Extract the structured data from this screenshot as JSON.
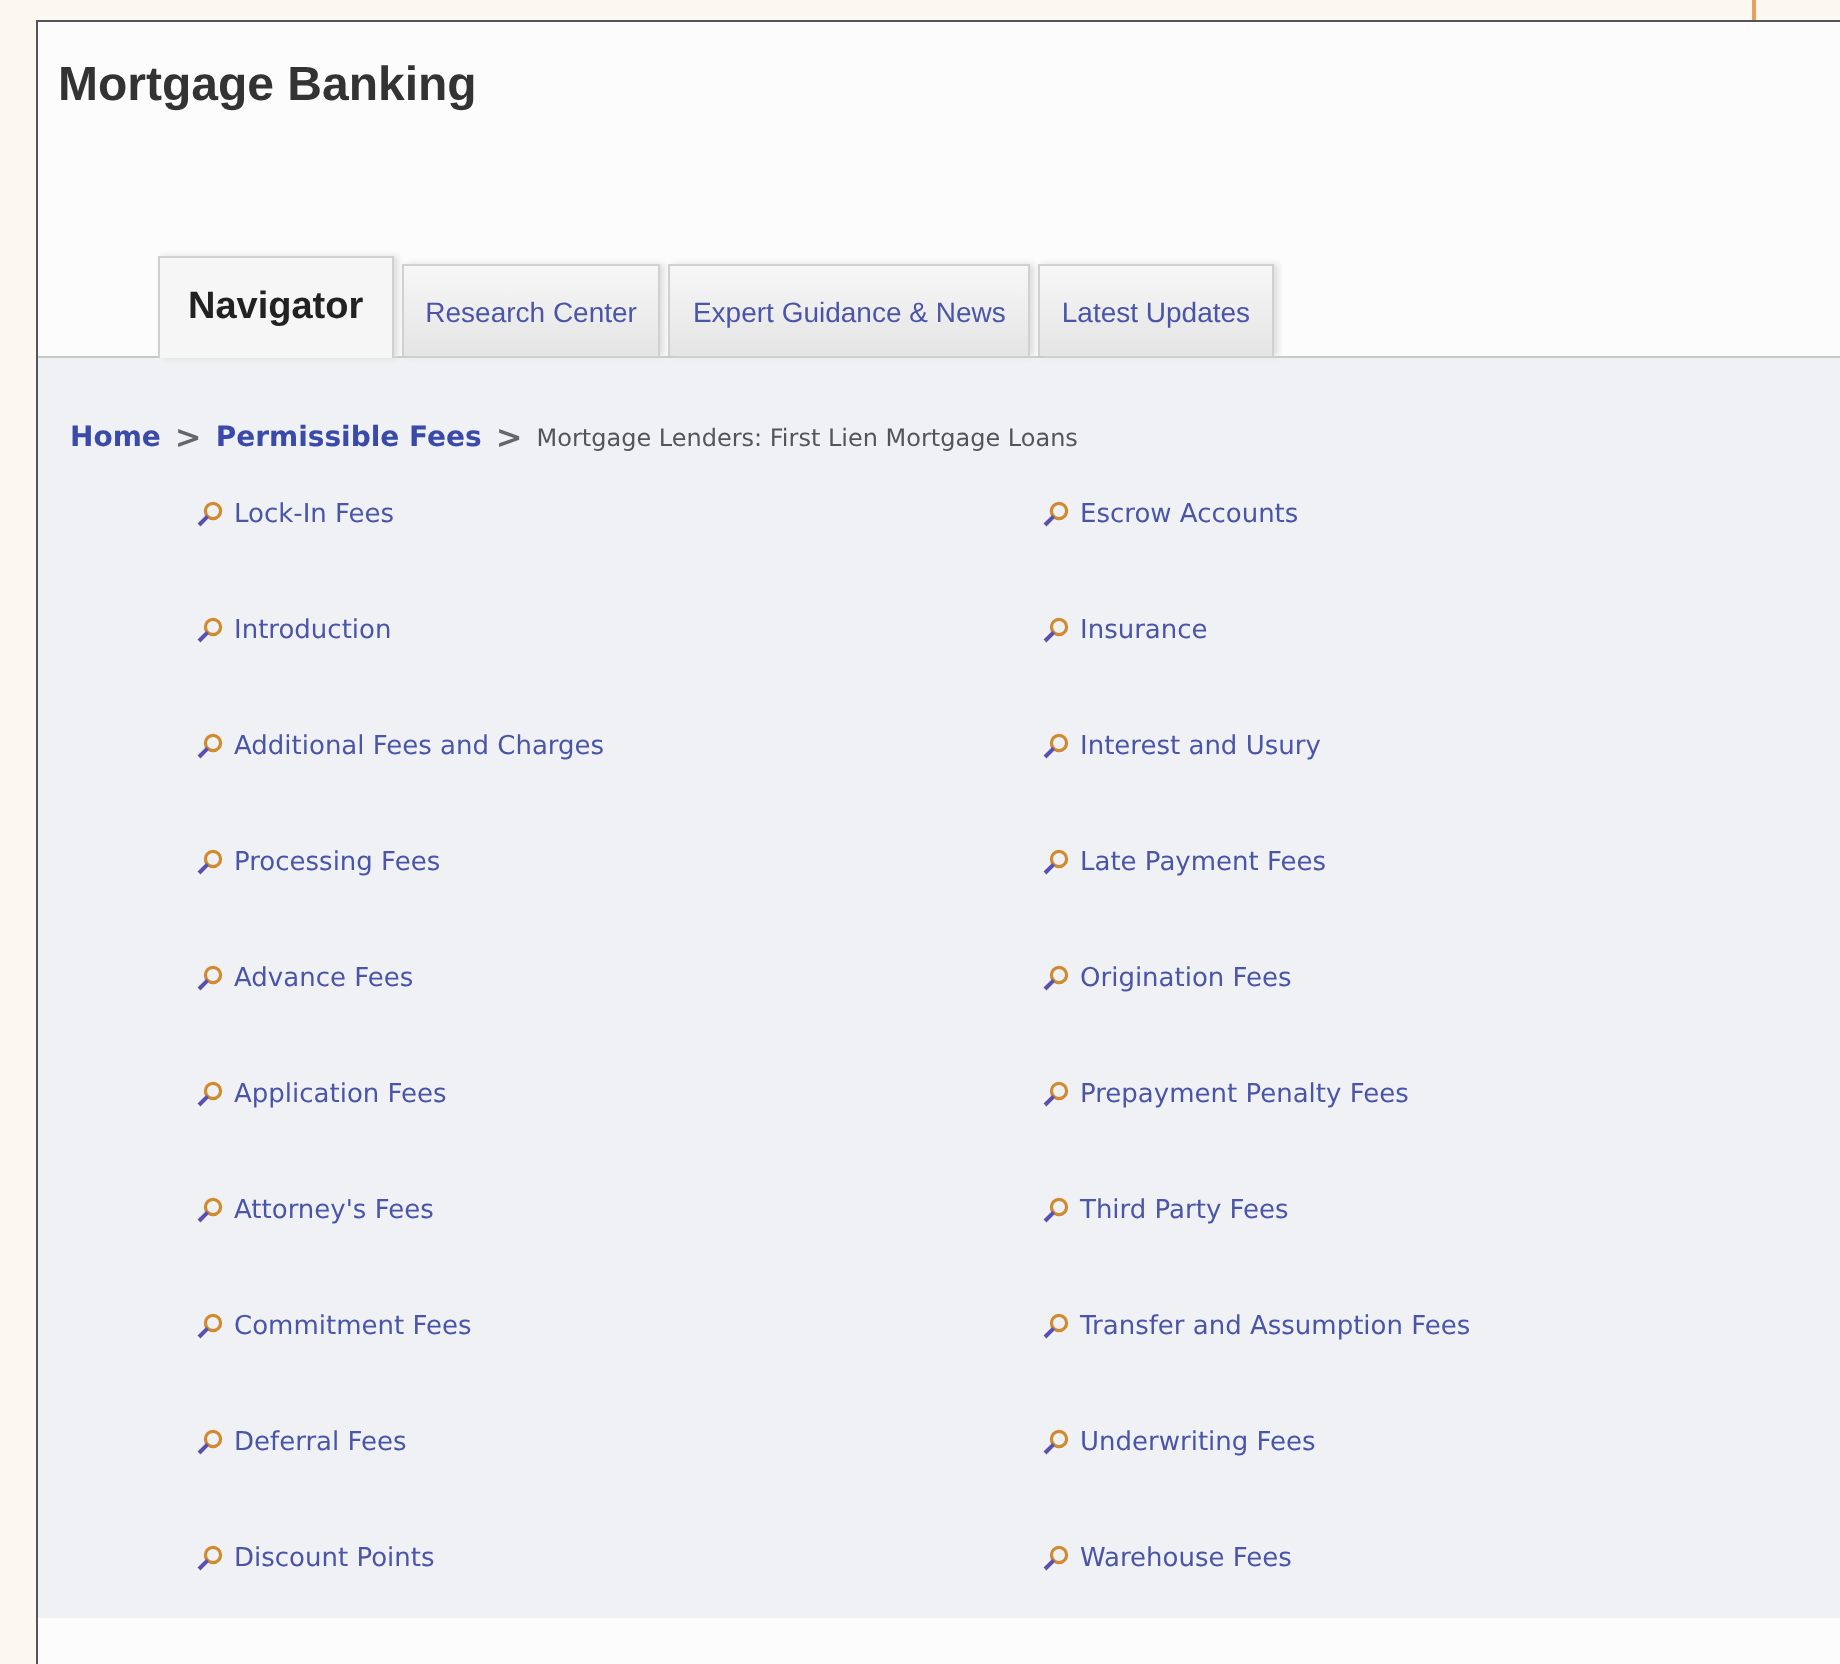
{
  "title": "Mortgage Banking",
  "tabs": [
    {
      "label": "Navigator",
      "selected": true
    },
    {
      "label": "Research Center",
      "selected": false
    },
    {
      "label": "Expert Guidance & News",
      "selected": false
    },
    {
      "label": "Latest Updates",
      "selected": false
    }
  ],
  "breadcrumb": {
    "links": [
      "Home",
      "Permissible Fees"
    ],
    "separator": ">",
    "current": "Mortgage Lenders: First Lien Mortgage Loans"
  },
  "topics": {
    "column_1": [
      "Lock-In Fees",
      "Introduction",
      "Additional Fees and Charges",
      "Processing Fees",
      "Advance Fees",
      "Application Fees",
      "Attorney's Fees",
      "Commitment Fees",
      "Deferral Fees",
      "Discount Points"
    ],
    "column_2": [
      "Escrow Accounts",
      "Insurance",
      "Interest and Usury",
      "Late Payment Fees",
      "Origination Fees",
      "Prepayment Penalty Fees",
      "Third Party Fees",
      "Transfer and Assumption Fees",
      "Underwriting Fees",
      "Warehouse Fees"
    ]
  }
}
